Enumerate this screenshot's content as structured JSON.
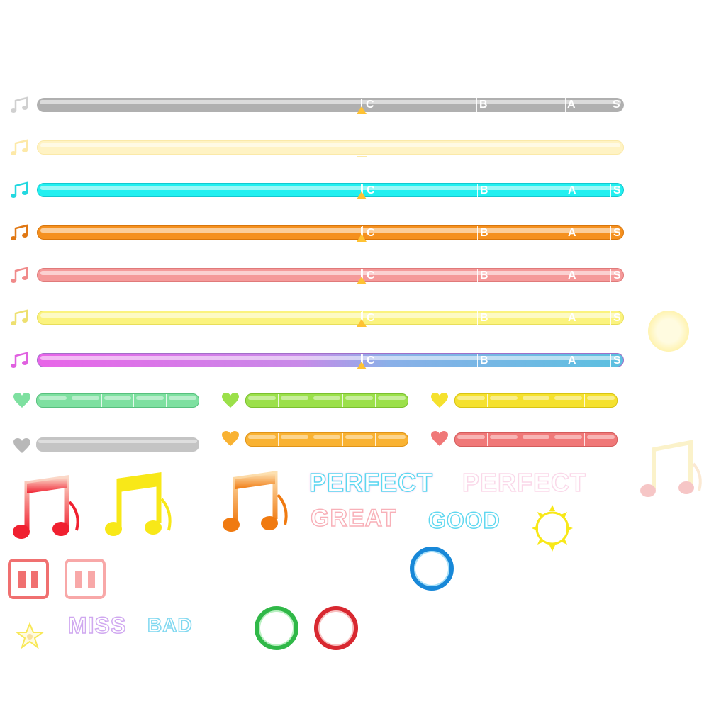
{
  "gauges": {
    "rank_labels": {
      "c": "C",
      "b": "B",
      "a": "A",
      "s": "S"
    },
    "colors": {
      "gray": "#b0b0b0",
      "cream": "#fff3c4",
      "cyan": "#22f0f0",
      "orange": "#f5901e",
      "pink": "#f59a9a",
      "yellow": "#fbf37e",
      "purple": "#e865e8",
      "blue": "#5bc0e0",
      "marker": "#ffc233"
    }
  },
  "life_colors": {
    "teal": "#7ee0a0",
    "lime": "#9be04a",
    "yellow": "#f5e12e",
    "gray": "#c4c4c4",
    "orange": "#f9b232",
    "red": "#f07878"
  },
  "judgements": {
    "perfect": "PERFECT",
    "perfect_alt": "PERFECT",
    "great": "GREAT",
    "good": "GOOD",
    "miss": "MISS",
    "bad": "BAD"
  },
  "icons": {
    "note": "music-note-icon",
    "heart": "heart-icon",
    "pause": "pause-icon",
    "star": "star-icon",
    "sun": "sun-icon",
    "ring": "ring-icon"
  }
}
